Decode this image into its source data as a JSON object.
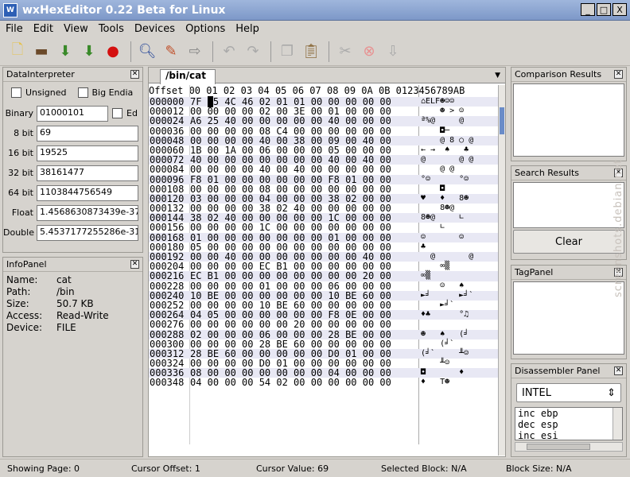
{
  "window": {
    "title": "wxHexEditor 0.22 Beta for Linux",
    "icon": "app-icon",
    "minimize": "_",
    "maximize": "□",
    "close": "X"
  },
  "menu": [
    "File",
    "Edit",
    "View",
    "Tools",
    "Devices",
    "Options",
    "Help"
  ],
  "toolbar": [
    "new-file-icon",
    "open-icon",
    "save-icon",
    "save-as-icon",
    "close-file-icon",
    "find-icon",
    "find-replace-icon",
    "goto-offset-icon",
    "undo-icon",
    "redo-icon",
    "copy-icon",
    "paste-icon",
    "cut-icon",
    "delete-icon",
    "insert-icon"
  ],
  "data_interpreter": {
    "title": "DataInterpreter",
    "unsigned_label": "Unsigned",
    "big_endian_label": "Big Endia",
    "edit_label": "Ed",
    "fields": [
      {
        "label": "Binary",
        "value": "01000101"
      },
      {
        "label": "8 bit",
        "value": "69"
      },
      {
        "label": "16 bit",
        "value": "19525"
      },
      {
        "label": "32 bit",
        "value": "38161477"
      },
      {
        "label": "64 bit",
        "value": "1103844756549"
      },
      {
        "label": "Float",
        "value": "1.4568630873439e-37"
      },
      {
        "label": "Double",
        "value": "5.4537177255286e-31"
      }
    ]
  },
  "info_panel": {
    "title": "InfoPanel",
    "rows": [
      {
        "k": "Name:",
        "v": "cat"
      },
      {
        "k": "Path:",
        "v": "/bin"
      },
      {
        "k": "Size:",
        "v": "50.7 KB"
      },
      {
        "k": "Access:",
        "v": "Read-Write"
      },
      {
        "k": "Device:",
        "v": "FILE"
      }
    ]
  },
  "hex": {
    "tab": "/bin/cat",
    "header": "Offset 00 01 02 03 04 05 06 07 08 09 0A 0B 0123456789AB",
    "rows": [
      {
        "off": "000000",
        "hex": "7F 45 4C 46 02 01 01 00 00 00 00 00",
        "txt": "⌂ELF☻☺☺"
      },
      {
        "off": "000012",
        "hex": "00 00 00 00 02 00 3E 00 01 00 00 00",
        "txt": "    ☻ > ☺"
      },
      {
        "off": "000024",
        "hex": "A6 25 40 00 00 00 00 00 40 00 00 00",
        "txt": "ª%@     @"
      },
      {
        "off": "000036",
        "hex": "00 00 00 00 08 C4 00 00 00 00 00 00",
        "txt": "    ◘─"
      },
      {
        "off": "000048",
        "hex": "00 00 00 00 40 00 38 00 09 00 40 00",
        "txt": "    @ 8 ○ @"
      },
      {
        "off": "000060",
        "hex": "1B 00 1A 00 06 00 00 00 05 00 00 00",
        "txt": "← →  ♠   ♣"
      },
      {
        "off": "000072",
        "hex": "40 00 00 00 00 00 00 00 40 00 40 00",
        "txt": "@       @ @"
      },
      {
        "off": "000084",
        "hex": "00 00 00 00 40 00 40 00 00 00 00 00",
        "txt": "    @ @"
      },
      {
        "off": "000096",
        "hex": "F8 01 00 00 00 00 00 00 F8 01 00 00",
        "txt": "°☺      °☺"
      },
      {
        "off": "000108",
        "hex": "00 00 00 00 08 00 00 00 00 00 00 00",
        "txt": "    ◘"
      },
      {
        "off": "000120",
        "hex": "03 00 00 00 04 00 00 00 38 02 00 00",
        "txt": "♥   ♦   8☻"
      },
      {
        "off": "000132",
        "hex": "00 00 00 00 38 02 40 00 00 00 00 00",
        "txt": "    8☻@"
      },
      {
        "off": "000144",
        "hex": "38 02 40 00 00 00 00 00 1C 00 00 00",
        "txt": "8☻@     ∟"
      },
      {
        "off": "000156",
        "hex": "00 00 00 00 1C 00 00 00 00 00 00 00",
        "txt": "    ∟"
      },
      {
        "off": "000168",
        "hex": "01 00 00 00 00 00 00 00 01 00 00 00",
        "txt": "☺       ☺"
      },
      {
        "off": "000180",
        "hex": "05 00 00 00 00 00 00 00 00 00 00 00",
        "txt": "♣"
      },
      {
        "off": "000192",
        "hex": "00 00 40 00 00 00 00 00 00 00 40 00",
        "txt": "  @       @"
      },
      {
        "off": "000204",
        "hex": "00 00 00 00 EC B1 00 00 00 00 00 00",
        "txt": "    ∞▒"
      },
      {
        "off": "000216",
        "hex": "EC B1 00 00 00 00 00 00 00 00 20 00",
        "txt": "∞▒"
      },
      {
        "off": "000228",
        "hex": "00 00 00 00 01 00 00 00 06 00 00 00",
        "txt": "    ☺   ♠"
      },
      {
        "off": "000240",
        "hex": "10 BE 00 00 00 00 00 00 10 BE 60 00",
        "txt": "►╛      ►╛`"
      },
      {
        "off": "000252",
        "hex": "00 00 00 00 10 BE 60 00 00 00 00 00",
        "txt": "    ►╛`"
      },
      {
        "off": "000264",
        "hex": "04 05 00 00 00 00 00 00 F8 0E 00 00",
        "txt": "♦♣      °♫"
      },
      {
        "off": "000276",
        "hex": "00 00 00 00 00 00 20 00 00 00 00 00",
        "txt": ""
      },
      {
        "off": "000288",
        "hex": "02 00 00 00 06 00 00 00 28 BE 00 00",
        "txt": "☻   ♠   (╛"
      },
      {
        "off": "000300",
        "hex": "00 00 00 00 28 BE 60 00 00 00 00 00",
        "txt": "    (╛`"
      },
      {
        "off": "000312",
        "hex": "28 BE 60 00 00 00 00 00 D0 01 00 00",
        "txt": "(╛`     ╨☺"
      },
      {
        "off": "000324",
        "hex": "00 00 00 00 D0 01 00 00 00 00 00 00",
        "txt": "    ╨☺"
      },
      {
        "off": "000336",
        "hex": "08 00 00 00 00 00 00 00 04 00 00 00",
        "txt": "◘       ♦"
      },
      {
        "off": "000348",
        "hex": "04 00 00 00 54 02 00 00 00 00 00 00",
        "txt": "♦   T☻"
      }
    ]
  },
  "comparison": {
    "title": "Comparison Results"
  },
  "search": {
    "title": "Search Results",
    "clear_label": "Clear"
  },
  "tag": {
    "title": "TagPanel"
  },
  "disasm": {
    "title": "Disassembler Panel",
    "arch": "INTEL",
    "lines": [
      "inc  ebp",
      "dec  esp",
      "inc  esi"
    ]
  },
  "status": {
    "page": "Showing Page: 0",
    "cursor_offset": "Cursor Offset: 1",
    "cursor_value": "Cursor Value: 69",
    "selected": "Selected Block: N/A",
    "block_size": "Block Size: N/A"
  },
  "watermark": "screenshots.debian.net"
}
